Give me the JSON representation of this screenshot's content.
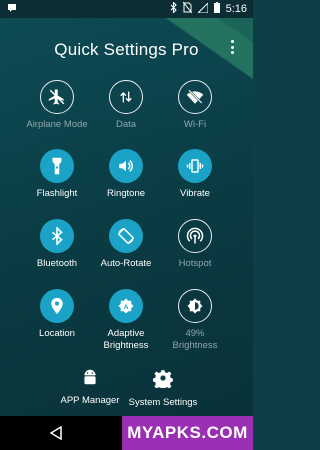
{
  "status_bar": {
    "time": "5:16",
    "icons": [
      "notification-icon",
      "bluetooth-icon",
      "no-sim-icon",
      "signal-icon",
      "battery-icon"
    ]
  },
  "header": {
    "title": "Quick Settings Pro"
  },
  "tiles": [
    {
      "id": "airplane",
      "label": "Airplane Mode",
      "icon": "airplane-off-icon",
      "state": "off"
    },
    {
      "id": "data",
      "label": "Data",
      "icon": "data-arrows-icon",
      "state": "off"
    },
    {
      "id": "wifi",
      "label": "Wi-Fi",
      "icon": "wifi-off-icon",
      "state": "off"
    },
    {
      "id": "flashlight",
      "label": "Flashlight",
      "icon": "flashlight-icon",
      "state": "on"
    },
    {
      "id": "ringtone",
      "label": "Ringtone",
      "icon": "speaker-icon",
      "state": "on"
    },
    {
      "id": "vibrate",
      "label": "Vibrate",
      "icon": "vibrate-icon",
      "state": "on"
    },
    {
      "id": "bluetooth",
      "label": "Bluetooth",
      "icon": "bluetooth-icon",
      "state": "on"
    },
    {
      "id": "autorotate",
      "label": "Auto-Rotate",
      "icon": "rotate-icon",
      "state": "on"
    },
    {
      "id": "hotspot",
      "label": "Hotspot",
      "icon": "hotspot-icon",
      "state": "off"
    },
    {
      "id": "location",
      "label": "Location",
      "icon": "location-pin-icon",
      "state": "on"
    },
    {
      "id": "adaptive",
      "label": "Adaptive Brightness",
      "icon": "auto-brightness-icon",
      "state": "on"
    },
    {
      "id": "brightness",
      "label": "49% Brightness",
      "icon": "brightness-icon",
      "state": "off"
    }
  ],
  "bottom": {
    "app_manager": "APP Manager",
    "system_settings": "System Settings"
  },
  "watermark": "MYAPKS.COM",
  "colors": {
    "accent": "#1aa3c6",
    "background": "#0d3f47",
    "watermark": "#9b2fb3"
  }
}
